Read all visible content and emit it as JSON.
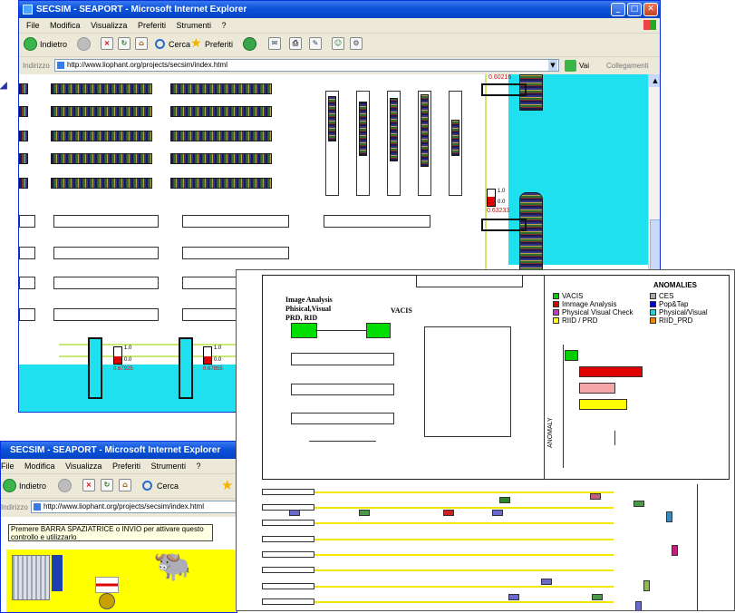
{
  "window_top": {
    "title": "SECSIM - SEAPORT - Microsoft Internet Explorer",
    "menu": [
      "File",
      "Modifica",
      "Visualizza",
      "Preferiti",
      "Strumenti",
      "?"
    ],
    "toolbar": {
      "back": "Indietro",
      "search": "Cerca",
      "favorites": "Preferiti"
    },
    "address": {
      "label": "Indirizzo",
      "url": "http://www.liophant.org/projects/secsim/index.html",
      "go": "Vai",
      "links": "Collegamenti"
    },
    "readouts": {
      "r1": "0.60216",
      "r2": "0.63233",
      "g_max": "1.0",
      "g_min": "0.0"
    },
    "gauges": {
      "g1_max": "1.0",
      "g1_min": "0.0",
      "g1_val": "0.67925",
      "g2_max": "1.0",
      "g2_min": "0.0",
      "g2_val": "0.67855"
    }
  },
  "panel": {
    "heading_left": "Image Analysis\nPhisical,Visual\nPRD, RID",
    "heading_vacis": "VACIS",
    "anomalies_title": "ANOMALIES",
    "legend_left": [
      {
        "label": "VACIS",
        "color": "#00cc00"
      },
      {
        "label": "Immage Analysis",
        "color": "#e00000"
      },
      {
        "label": "Physical Visual Check",
        "color": "#cc33cc"
      },
      {
        "label": "RIID / PRD",
        "color": "#ffff00"
      }
    ],
    "legend_right": [
      {
        "label": "CES",
        "color": "#aaaaaa"
      },
      {
        "label": "Pop&Tap",
        "color": "#0000cc"
      },
      {
        "label": "Physical/Visual",
        "color": "#33cccc"
      },
      {
        "label": "RIID_PRD",
        "color": "#ee8800"
      }
    ],
    "anomaly_axis_label": "ANOMALY",
    "bars": [
      {
        "name": "VACIS",
        "color": "#00cc00",
        "value": 0.2
      },
      {
        "name": "Immage Analysis",
        "color": "#e00000",
        "value": 0.92
      },
      {
        "name": "Physical Visual Check",
        "color": "#f4a6a6",
        "value": 0.52
      },
      {
        "name": "RIID / PRD",
        "color": "#ffff00",
        "value": 0.7
      }
    ]
  },
  "window_bottom": {
    "title": "SECSIM - SEAPORT - Microsoft Internet Explorer",
    "menu": [
      "File",
      "Modifica",
      "Visualizza",
      "Preferiti",
      "Strumenti",
      "?"
    ],
    "back": "Indietro",
    "search": "Cerca",
    "address_label": "Indirizzo",
    "url": "http://www.liophant.org/projects/secsim/index.html",
    "tooltip": "Premere BARRA SPAZIATRICE o INVIO per attivare questo controllo e utilizzarlo"
  }
}
